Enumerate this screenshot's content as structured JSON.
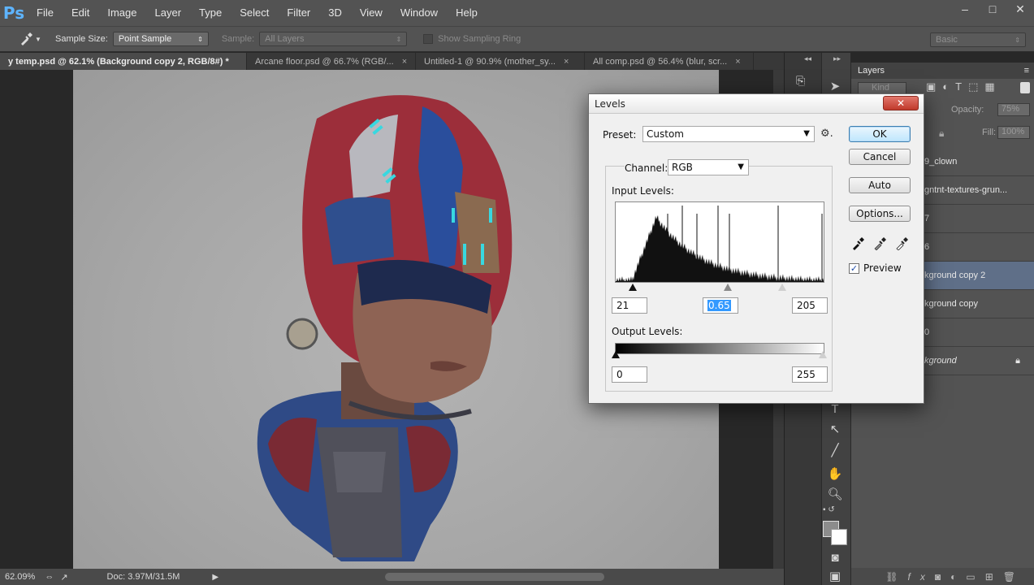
{
  "app": {
    "logo": "Ps",
    "menu": [
      "File",
      "Edit",
      "Image",
      "Layer",
      "Type",
      "Select",
      "Filter",
      "3D",
      "View",
      "Window",
      "Help"
    ],
    "window_controls": [
      "–",
      "□",
      "✕"
    ]
  },
  "options_bar": {
    "sample_size_label": "Sample Size:",
    "sample_size_value": "Point Sample",
    "sample_label": "Sample:",
    "sample_value": "All Layers",
    "sampling_ring_label": "Show Sampling Ring",
    "workspace": "Basic"
  },
  "tabs": [
    {
      "label": "y temp.psd @ 62.1% (Background copy 2, RGB/8#) *",
      "close": "×",
      "active": true
    },
    {
      "label": "Arcane floor.psd @ 66.7% (RGB/...",
      "close": "×",
      "active": false
    },
    {
      "label": "Untitled-1 @ 90.9% (mother_sy...",
      "close": "×",
      "active": false
    },
    {
      "label": "All comp.psd @ 56.4% (blur, scr...",
      "close": "×",
      "active": false
    }
  ],
  "status_bar": {
    "zoom": "62.09%",
    "doc": "Doc: 3.97M/31.5M"
  },
  "layers_panel": {
    "title": "Layers",
    "kind_label": "Kind",
    "opacity_label": "Opacity:",
    "opacity_value": "75%",
    "fill_label": "Fill:",
    "fill_value": "100%",
    "layers": [
      {
        "name": "9_clown"
      },
      {
        "name": "gntnt-textures-grun..."
      },
      {
        "name": "7"
      },
      {
        "name": "6"
      },
      {
        "name": "kground copy 2"
      },
      {
        "name": "kground copy"
      },
      {
        "name": "0"
      },
      {
        "name": "kground"
      }
    ]
  },
  "levels_dialog": {
    "title": "Levels",
    "close": "✕",
    "preset_label": "Preset:",
    "preset_value": "Custom",
    "channel_label": "Channel:",
    "channel_value": "RGB",
    "input_levels_label": "Input Levels:",
    "input_black": "21",
    "input_gamma": "0.65",
    "input_white": "205",
    "output_levels_label": "Output Levels:",
    "output_black": "0",
    "output_white": "255",
    "buttons": {
      "ok": "OK",
      "cancel": "Cancel",
      "auto": "Auto",
      "options": "Options..."
    },
    "preview_label": "Preview",
    "preview_checked": true
  },
  "colors": {
    "accent_selection": "#3399ff",
    "selected_layer": "#5f6f88",
    "ps_blue": "#5eb4ff"
  }
}
